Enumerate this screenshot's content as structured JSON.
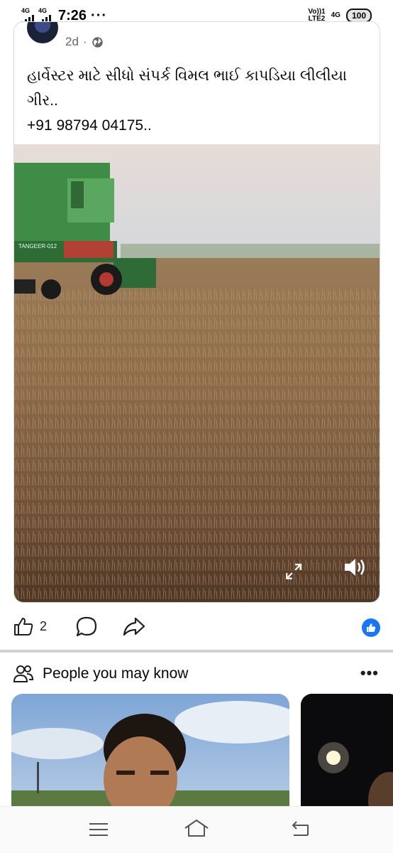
{
  "status_bar": {
    "network_1": "4G",
    "network_2": "4G",
    "time": "7:26",
    "overflow": "···",
    "volte_top": "Vo))1",
    "volte_bottom": "LTE2",
    "net_right": "4G",
    "battery": "100"
  },
  "post": {
    "timestamp": "2d",
    "separator": "·",
    "text_lines": [
      "હાર્વેસ્ટર માટે સીધો સંપર્ક વિમલ ભાઈ કાપડિયા લીલીયા",
      "ગીર..",
      "+91 98794 04175.."
    ],
    "video": {
      "machine_label": "TANGEER-012",
      "expand_icon": "expand-icon",
      "volume_icon": "volume-on-icon"
    }
  },
  "actions": {
    "like_count": "2",
    "reaction": "like-reaction-icon",
    "like_reaction_color": "#1877f2"
  },
  "pymk": {
    "title": "People you may know",
    "more": "•••"
  },
  "nav": {
    "menu": "menu-icon",
    "home": "home-icon",
    "back": "back-icon"
  }
}
